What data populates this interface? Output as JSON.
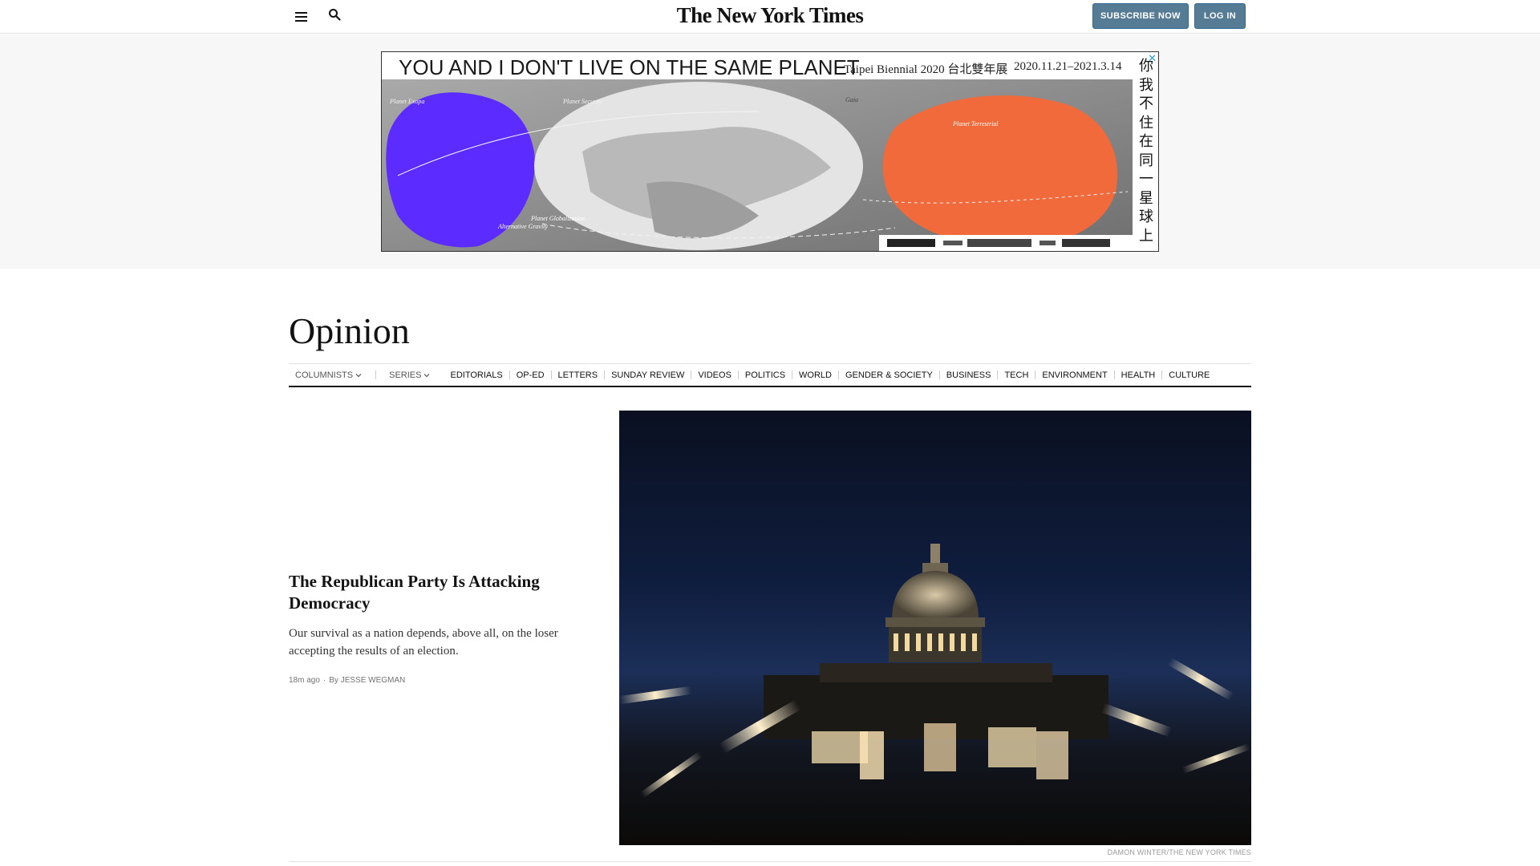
{
  "header": {
    "masthead": "The New York Times",
    "subscribe_label": "SUBSCRIBE NOW",
    "login_label": "LOG IN"
  },
  "ad": {
    "headline": "YOU AND I DON'T LIVE ON THE SAME PLANET",
    "biennial": "Taipei Biennial 2020 台北雙年展",
    "dates": "2020.11.21–2021.3.14",
    "vertical_chars": [
      "你",
      "我",
      "不",
      "住",
      "在",
      "同",
      "一",
      "星",
      "球",
      "上"
    ],
    "close_symbol": "✕",
    "map_labels": [
      "Planet Exopa",
      "Planet Security",
      "Gaia",
      "Planet Terrestrial",
      "Planet Globalization",
      "Alternative Gravity"
    ],
    "colors": {
      "purple": "#5b2bff",
      "orange": "#f06a3c",
      "grey": "#8c8c8c"
    }
  },
  "section": {
    "title": "Opinion",
    "nav": [
      {
        "label": "COLUMNISTS",
        "dropdown": true,
        "dim": true
      },
      {
        "label": "SERIES",
        "dropdown": true,
        "dim": true
      },
      {
        "label": "EDITORIALS"
      },
      {
        "label": "OP-ED"
      },
      {
        "label": "LETTERS"
      },
      {
        "label": "SUNDAY REVIEW"
      },
      {
        "label": "VIDEOS"
      },
      {
        "label": "POLITICS"
      },
      {
        "label": "WORLD"
      },
      {
        "label": "GENDER & SOCIETY"
      },
      {
        "label": "BUSINESS"
      },
      {
        "label": "TECH"
      },
      {
        "label": "ENVIRONMENT"
      },
      {
        "label": "HEALTH"
      },
      {
        "label": "CULTURE"
      }
    ]
  },
  "story": {
    "headline": "The Republican Party Is Attacking Democracy",
    "summary": "Our survival as a nation depends, above all, on the loser accepting the results of an election.",
    "time": "18m ago",
    "byline": "By JESSE WEGMAN",
    "photo_credit": "DAMON WINTER/THE NEW YORK TIMES"
  }
}
